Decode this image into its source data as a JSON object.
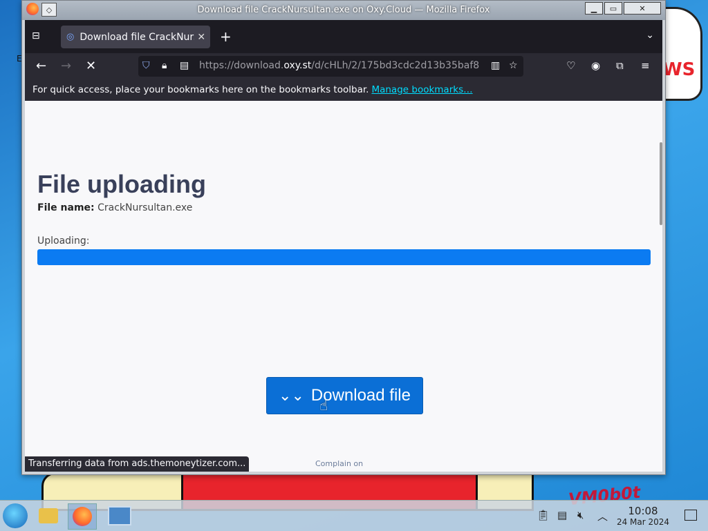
{
  "window": {
    "title": "Download file CrackNursultan.exe on Oxy.Cloud — Mozilla Firefox",
    "controls": [
      "minimize",
      "maximize",
      "close"
    ]
  },
  "tabs": [
    {
      "label": "Download file CrackNursultan.exe",
      "icon": "oxy-cloud-icon",
      "active": true
    }
  ],
  "navbar": {
    "url_prefix": "https://download.",
    "url_domain": "oxy.st",
    "url_path": "/d/cHLh/2/175bd3cdc2d13b35baf8"
  },
  "bookmarks_bar": {
    "text": "For quick access, place your bookmarks here on the bookmarks toolbar.",
    "link": "Manage bookmarks…"
  },
  "page": {
    "heading": "File uploading",
    "file_name_label": "File name:",
    "file_name": "CrackNursultan.exe",
    "uploading_label": "Uploading:",
    "progress_fraction": 1.0,
    "progress_color": "#0b7bf2",
    "download_button": "Download file",
    "complain_text": "Complain on"
  },
  "status_bar": "Transferring data from ads.themoneytizer.com...",
  "desktop": {
    "wallpaper_text": "VM0b0t",
    "wallpaper_text_2": "WS"
  },
  "taskbar": {
    "time": "10:08",
    "date": "24 Mar 2024"
  }
}
